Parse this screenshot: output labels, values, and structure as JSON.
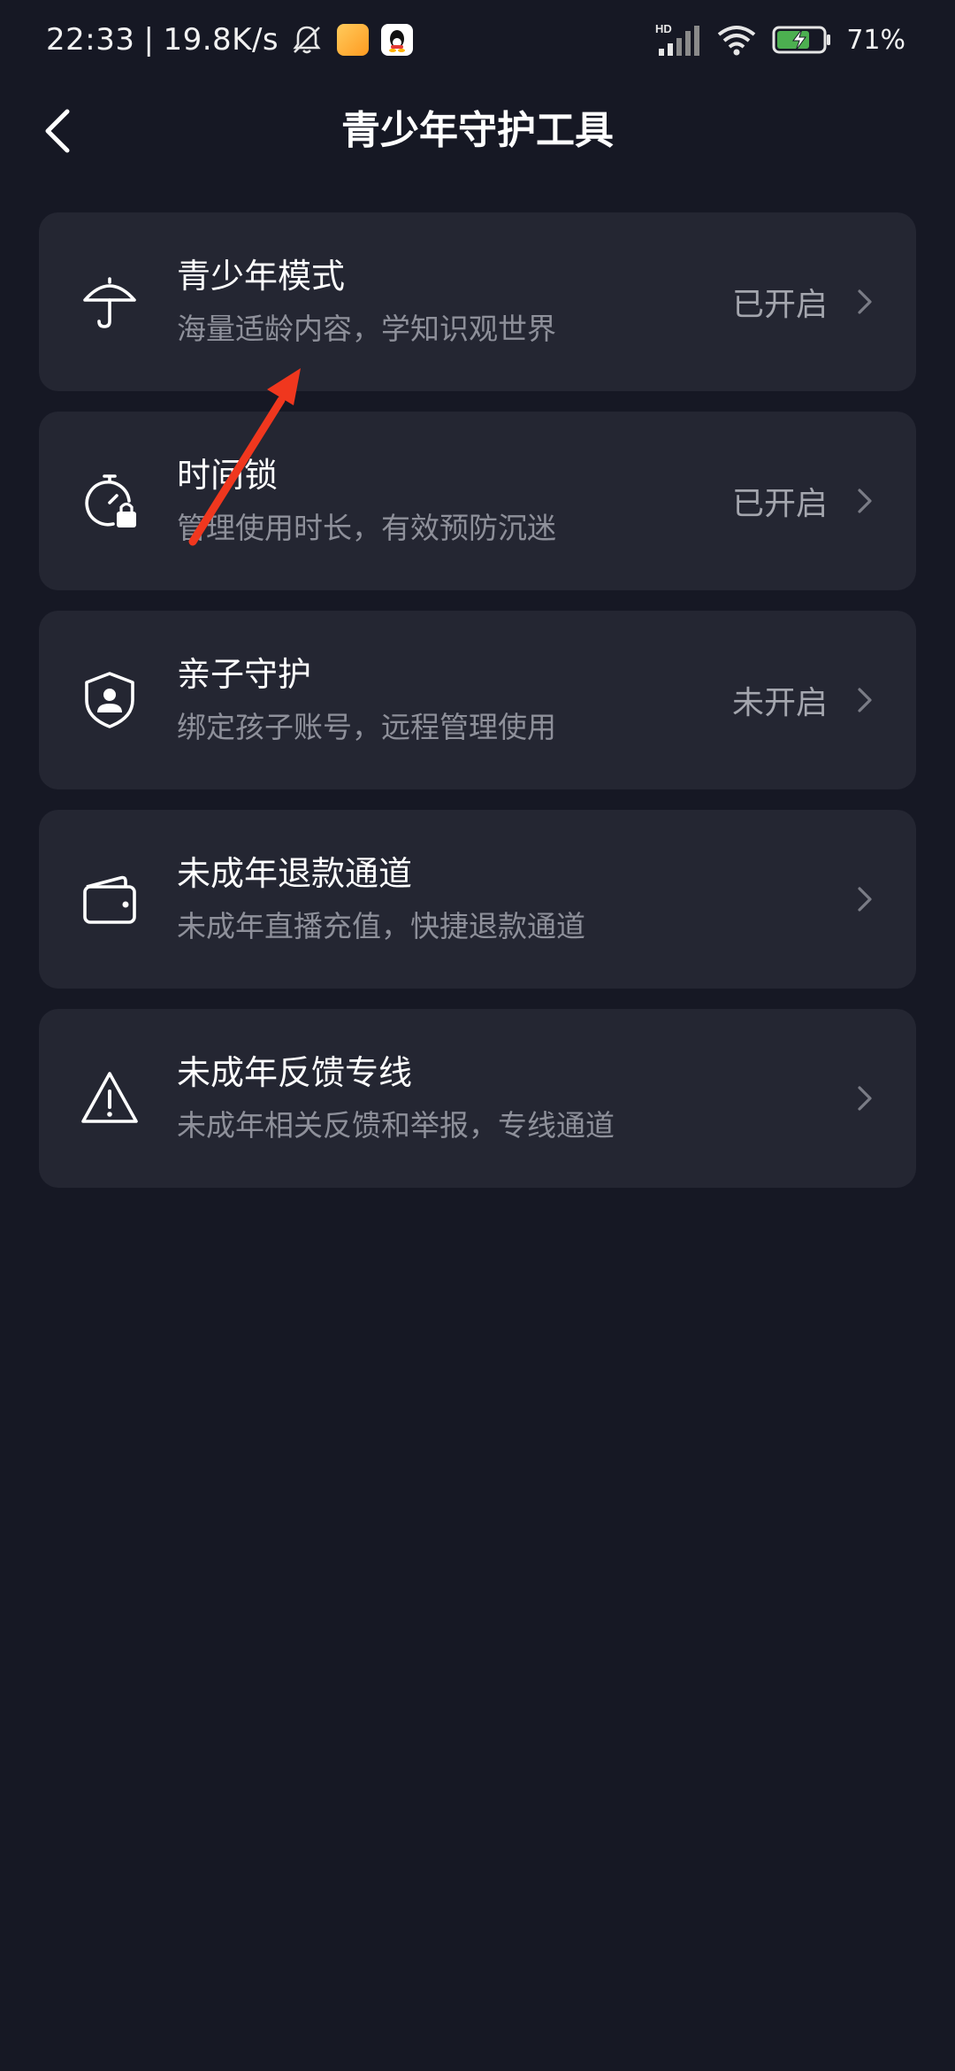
{
  "status_bar": {
    "time": "22:33",
    "separator": "|",
    "net_speed": "19.8K/s",
    "network": "HD",
    "battery": "71%"
  },
  "header": {
    "title": "青少年守护工具"
  },
  "items": [
    {
      "title": "青少年模式",
      "subtitle": "海量适龄内容，学知识观世界",
      "status": "已开启",
      "icon": "umbrella-icon"
    },
    {
      "title": "时间锁",
      "subtitle": "管理使用时长，有效预防沉迷",
      "status": "已开启",
      "icon": "timer-lock-icon"
    },
    {
      "title": "亲子守护",
      "subtitle": "绑定孩子账号，远程管理使用",
      "status": "未开启",
      "icon": "shield-person-icon"
    },
    {
      "title": "未成年退款通道",
      "subtitle": "未成年直播充值，快捷退款通道",
      "status": "",
      "icon": "wallet-icon"
    },
    {
      "title": "未成年反馈专线",
      "subtitle": "未成年相关反馈和举报，专线通道",
      "status": "",
      "icon": "warning-icon"
    }
  ],
  "colors": {
    "background": "#161824",
    "card": "#242632",
    "annotation_arrow": "#f0371e"
  }
}
